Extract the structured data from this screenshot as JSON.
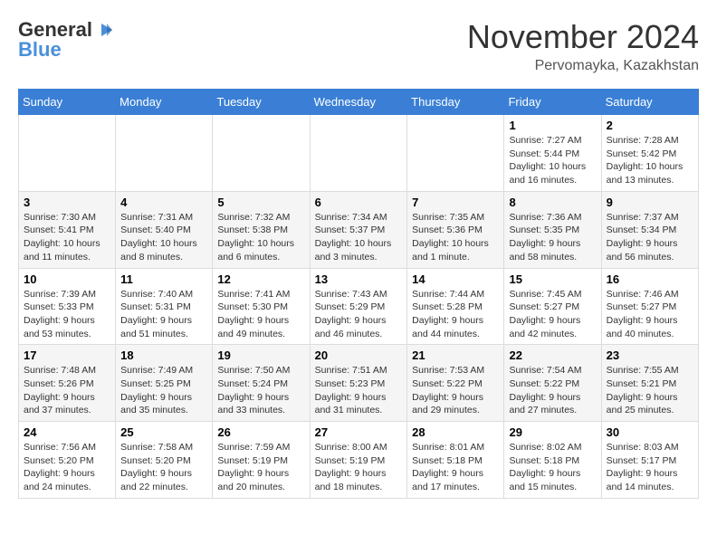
{
  "logo": {
    "general": "General",
    "blue": "Blue"
  },
  "title": "November 2024",
  "location": "Pervomayka, Kazakhstan",
  "days_of_week": [
    "Sunday",
    "Monday",
    "Tuesday",
    "Wednesday",
    "Thursday",
    "Friday",
    "Saturday"
  ],
  "weeks": [
    [
      {
        "day": "",
        "info": ""
      },
      {
        "day": "",
        "info": ""
      },
      {
        "day": "",
        "info": ""
      },
      {
        "day": "",
        "info": ""
      },
      {
        "day": "",
        "info": ""
      },
      {
        "day": "1",
        "info": "Sunrise: 7:27 AM\nSunset: 5:44 PM\nDaylight: 10 hours and 16 minutes."
      },
      {
        "day": "2",
        "info": "Sunrise: 7:28 AM\nSunset: 5:42 PM\nDaylight: 10 hours and 13 minutes."
      }
    ],
    [
      {
        "day": "3",
        "info": "Sunrise: 7:30 AM\nSunset: 5:41 PM\nDaylight: 10 hours and 11 minutes."
      },
      {
        "day": "4",
        "info": "Sunrise: 7:31 AM\nSunset: 5:40 PM\nDaylight: 10 hours and 8 minutes."
      },
      {
        "day": "5",
        "info": "Sunrise: 7:32 AM\nSunset: 5:38 PM\nDaylight: 10 hours and 6 minutes."
      },
      {
        "day": "6",
        "info": "Sunrise: 7:34 AM\nSunset: 5:37 PM\nDaylight: 10 hours and 3 minutes."
      },
      {
        "day": "7",
        "info": "Sunrise: 7:35 AM\nSunset: 5:36 PM\nDaylight: 10 hours and 1 minute."
      },
      {
        "day": "8",
        "info": "Sunrise: 7:36 AM\nSunset: 5:35 PM\nDaylight: 9 hours and 58 minutes."
      },
      {
        "day": "9",
        "info": "Sunrise: 7:37 AM\nSunset: 5:34 PM\nDaylight: 9 hours and 56 minutes."
      }
    ],
    [
      {
        "day": "10",
        "info": "Sunrise: 7:39 AM\nSunset: 5:33 PM\nDaylight: 9 hours and 53 minutes."
      },
      {
        "day": "11",
        "info": "Sunrise: 7:40 AM\nSunset: 5:31 PM\nDaylight: 9 hours and 51 minutes."
      },
      {
        "day": "12",
        "info": "Sunrise: 7:41 AM\nSunset: 5:30 PM\nDaylight: 9 hours and 49 minutes."
      },
      {
        "day": "13",
        "info": "Sunrise: 7:43 AM\nSunset: 5:29 PM\nDaylight: 9 hours and 46 minutes."
      },
      {
        "day": "14",
        "info": "Sunrise: 7:44 AM\nSunset: 5:28 PM\nDaylight: 9 hours and 44 minutes."
      },
      {
        "day": "15",
        "info": "Sunrise: 7:45 AM\nSunset: 5:27 PM\nDaylight: 9 hours and 42 minutes."
      },
      {
        "day": "16",
        "info": "Sunrise: 7:46 AM\nSunset: 5:27 PM\nDaylight: 9 hours and 40 minutes."
      }
    ],
    [
      {
        "day": "17",
        "info": "Sunrise: 7:48 AM\nSunset: 5:26 PM\nDaylight: 9 hours and 37 minutes."
      },
      {
        "day": "18",
        "info": "Sunrise: 7:49 AM\nSunset: 5:25 PM\nDaylight: 9 hours and 35 minutes."
      },
      {
        "day": "19",
        "info": "Sunrise: 7:50 AM\nSunset: 5:24 PM\nDaylight: 9 hours and 33 minutes."
      },
      {
        "day": "20",
        "info": "Sunrise: 7:51 AM\nSunset: 5:23 PM\nDaylight: 9 hours and 31 minutes."
      },
      {
        "day": "21",
        "info": "Sunrise: 7:53 AM\nSunset: 5:22 PM\nDaylight: 9 hours and 29 minutes."
      },
      {
        "day": "22",
        "info": "Sunrise: 7:54 AM\nSunset: 5:22 PM\nDaylight: 9 hours and 27 minutes."
      },
      {
        "day": "23",
        "info": "Sunrise: 7:55 AM\nSunset: 5:21 PM\nDaylight: 9 hours and 25 minutes."
      }
    ],
    [
      {
        "day": "24",
        "info": "Sunrise: 7:56 AM\nSunset: 5:20 PM\nDaylight: 9 hours and 24 minutes."
      },
      {
        "day": "25",
        "info": "Sunrise: 7:58 AM\nSunset: 5:20 PM\nDaylight: 9 hours and 22 minutes."
      },
      {
        "day": "26",
        "info": "Sunrise: 7:59 AM\nSunset: 5:19 PM\nDaylight: 9 hours and 20 minutes."
      },
      {
        "day": "27",
        "info": "Sunrise: 8:00 AM\nSunset: 5:19 PM\nDaylight: 9 hours and 18 minutes."
      },
      {
        "day": "28",
        "info": "Sunrise: 8:01 AM\nSunset: 5:18 PM\nDaylight: 9 hours and 17 minutes."
      },
      {
        "day": "29",
        "info": "Sunrise: 8:02 AM\nSunset: 5:18 PM\nDaylight: 9 hours and 15 minutes."
      },
      {
        "day": "30",
        "info": "Sunrise: 8:03 AM\nSunset: 5:17 PM\nDaylight: 9 hours and 14 minutes."
      }
    ]
  ]
}
